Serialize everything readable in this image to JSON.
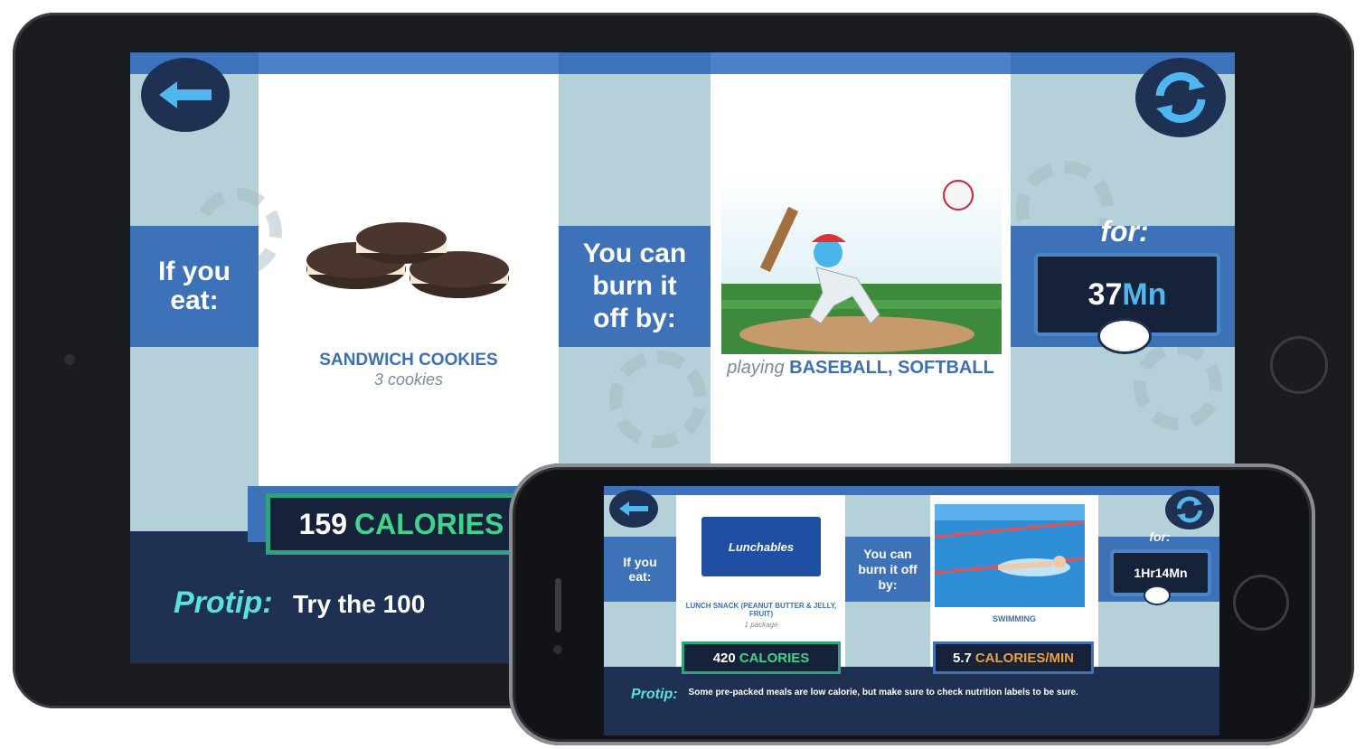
{
  "tablet": {
    "back_icon": "arrow-left-icon",
    "refresh_icon": "refresh-icon",
    "eat_label": "If you eat:",
    "food": {
      "name": "SANDWICH COOKIES",
      "serving": "3 cookies"
    },
    "burn_label": "You can burn it off by:",
    "activity": {
      "prefix": "playing",
      "name": "BASEBALL, SOFTBALL"
    },
    "for_label": "for:",
    "duration": {
      "value": "37",
      "unit": "Mn"
    },
    "calories": {
      "value": "159",
      "unit": "CALORIES"
    },
    "protip": {
      "label": "Protip:",
      "text": "Try the 100"
    }
  },
  "phone": {
    "back_icon": "arrow-left-icon",
    "refresh_icon": "refresh-icon",
    "eat_label": "If you eat:",
    "food": {
      "name": "LUNCH SNACK (PEANUT BUTTER & JELLY, FRUIT)",
      "serving": "1 package",
      "package_text": "Lunchables"
    },
    "burn_label": "You can burn it off by:",
    "activity": {
      "name": "SWIMMING"
    },
    "for_label": "for:",
    "duration": "1Hr14Mn",
    "calories": {
      "value": "420",
      "unit": "CALORIES"
    },
    "rate": {
      "value": "5.7",
      "unit": "CALORIES/MIN"
    },
    "protip": {
      "label": "Protip:",
      "text": "Some pre-packed meals are low calorie, but make sure to check nutrition labels to be sure."
    }
  },
  "colors": {
    "accent_blue": "#3d72b9",
    "navy": "#1f3152",
    "calorie_green": "#3fd48b",
    "protip_cyan": "#5be0e0"
  }
}
